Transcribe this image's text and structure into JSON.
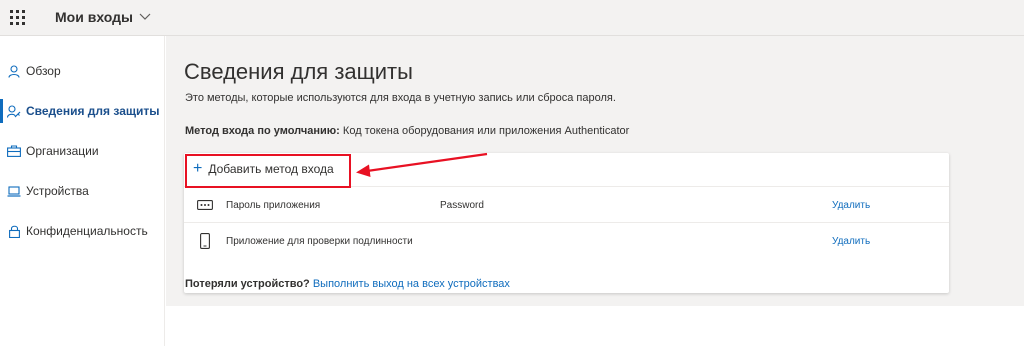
{
  "header": {
    "app_title": "Мои входы",
    "waffle_icon": "app-launcher-icon",
    "dropdown_icon": "chevron-down-icon"
  },
  "sidebar": {
    "items": [
      {
        "label": "Обзор",
        "icon": "person-icon",
        "active": false
      },
      {
        "label": "Сведения для защиты",
        "icon": "person-key-icon",
        "active": true
      },
      {
        "label": "Организации",
        "icon": "briefcase-icon",
        "active": false
      },
      {
        "label": "Устройства",
        "icon": "laptop-icon",
        "active": false
      },
      {
        "label": "Конфиденциальность",
        "icon": "lock-icon",
        "active": false
      }
    ]
  },
  "main": {
    "title": "Сведения для защиты",
    "description": "Это методы, которые используются для входа в учетную запись или сброса пароля.",
    "default_method_label": "Метод входа по умолчанию:",
    "default_method_value": "Код токена оборудования или приложения Authenticator",
    "add_method_label": "Добавить метод входа",
    "methods": [
      {
        "icon": "dots-password-icon",
        "name": "Пароль приложения",
        "detail": "Password",
        "action": "Удалить"
      },
      {
        "icon": "phone-icon",
        "name": "Приложение для проверки подлинности",
        "detail": "",
        "action": "Удалить"
      }
    ],
    "lost_device_label": "Потеряли устройство?",
    "lost_device_link": "Выполнить выход на всех устройствах"
  },
  "colors": {
    "accent": "#0f6cbd",
    "highlight": "#e81123",
    "background": "#f3f2f1"
  }
}
